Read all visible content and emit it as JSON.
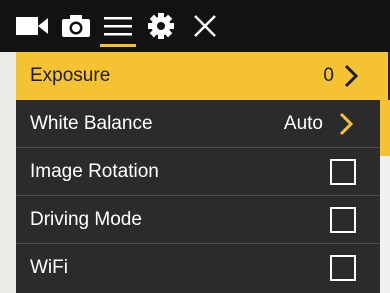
{
  "toolbar": {
    "icons": [
      "video-camera-icon",
      "photo-camera-icon",
      "menu-icon",
      "gear-icon",
      "close-icon"
    ],
    "active_tab": "menu-icon",
    "accent_color": "#f5c332"
  },
  "menu": {
    "items": [
      {
        "label": "Exposure",
        "value": "0",
        "control": "chevron",
        "selected": true
      },
      {
        "label": "White Balance",
        "value": "Auto",
        "control": "chevron",
        "selected": false
      },
      {
        "label": "Image Rotation",
        "control": "checkbox",
        "checked": false
      },
      {
        "label": "Driving Mode",
        "control": "checkbox",
        "checked": false
      },
      {
        "label": "WiFi",
        "control": "checkbox",
        "checked": false
      }
    ]
  }
}
